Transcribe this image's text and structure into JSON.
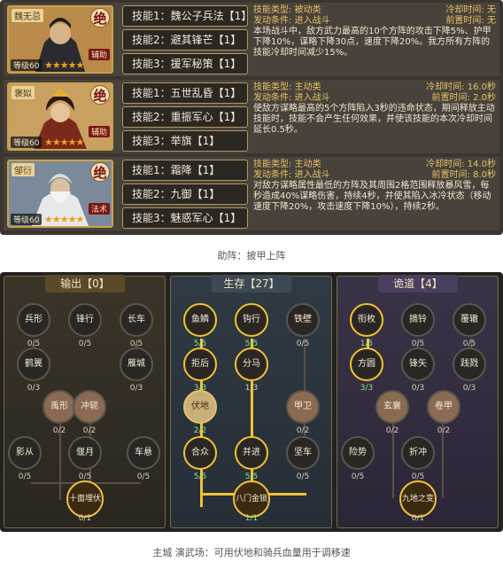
{
  "heroes": [
    {
      "name": "魏无忌",
      "badge": "绝",
      "tag": "辅助",
      "level": "等级60",
      "stars": "★★★★★",
      "skills": [
        "技能1：魏公子兵法【1】",
        "技能2：避其锋芒【1】",
        "技能3：援军秘策【1】"
      ],
      "type": "技能类型: 被动类",
      "condition": "发动条件: 进入战斗",
      "cooldown": "冷却时间: 无",
      "precast": "前置时间: 无",
      "text": "本场战斗中，敌方武力最高的10个方阵的攻击下降5%、护甲下降10%，谋略下降30点，速度下降20%。我方所有方阵的技能冷却时间减少15%。"
    },
    {
      "name": "褒姒",
      "badge": "绝",
      "tag": "辅助",
      "level": "等级60",
      "stars": "★★★★★",
      "skills": [
        "技能1：五世乱昏【1】",
        "技能2：重振军心【1】",
        "技能3：举旗【1】"
      ],
      "type": "技能类型: 主动类",
      "condition": "发动条件: 进入战斗",
      "cooldown": "冷却时间: 16.0秒",
      "precast": "前置时间: 2.0秒",
      "text": "使敌方谋略最高的5个方阵陷入3秒的违命状态，期间释放主动技能时，技能不会产生任何效果，并使该技能的本次冷却时间延长0.5秒。"
    },
    {
      "name": "邹衍",
      "badge": "绝",
      "tag": "法术",
      "level": "等级60",
      "stars": "★★★★★",
      "skills": [
        "技能1：霜降【1】",
        "技能2：九御【1】",
        "技能3：魅惑军心【1】"
      ],
      "type": "技能类型: 主动类",
      "condition": "发动条件: 进入战斗",
      "cooldown": "冷却时间: 14.0秒",
      "precast": "前置时间: 8.0秒",
      "text": "对敌方谋略属性最低的方阵及其周围2格范围释放暴风雪，每秒造成40%谋略伤害，持续4秒，并使其陷入冰冷状态（移动速度下降20%，攻击速度下降10%），持续2秒。"
    }
  ],
  "caption1": "助阵：披甲上阵",
  "caption2": "主城 演武场：可用伏地和骑兵血量用于调移速",
  "columns": [
    {
      "title": "输出【0】",
      "nodes": [
        {
          "label": "兵形",
          "count": "0/5"
        },
        {
          "label": "锋行",
          "count": "0/5"
        },
        {
          "label": "长车",
          "count": "0/5"
        },
        {
          "label": "鹤翼",
          "count": "0/3"
        },
        {
          "label": "雁城",
          "count": "0/3"
        },
        {
          "label": "禹形",
          "count": "0/2"
        },
        {
          "label": "冲轭",
          "count": "0/2"
        },
        {
          "label": "影从",
          "count": "0/5"
        },
        {
          "label": "偃月",
          "count": "0/5"
        },
        {
          "label": "车悬",
          "count": "0/5"
        },
        {
          "label": "十面埋伏",
          "count": "0/1"
        }
      ]
    },
    {
      "title": "生存【27】",
      "nodes": [
        {
          "label": "鱼鳞",
          "count": "5/5"
        },
        {
          "label": "钩行",
          "count": "5/5"
        },
        {
          "label": "铁壁",
          "count": "0/5"
        },
        {
          "label": "拒后",
          "count": "3/3"
        },
        {
          "label": "分马",
          "count": "1/3"
        },
        {
          "label": "伏地",
          "count": "2/2"
        },
        {
          "label": "甲卫",
          "count": "0/2"
        },
        {
          "label": "合众",
          "count": "5/5"
        },
        {
          "label": "并进",
          "count": "5/5"
        },
        {
          "label": "坚车",
          "count": "0/5"
        },
        {
          "label": "八门金锁",
          "count": "1/1"
        }
      ]
    },
    {
      "title": "诡道【4】",
      "nodes": [
        {
          "label": "衔枚",
          "count": "1/5"
        },
        {
          "label": "摘铃",
          "count": "0/5"
        },
        {
          "label": "覆辙",
          "count": "0/5"
        },
        {
          "label": "方圆",
          "count": "3/3"
        },
        {
          "label": "锋矢",
          "count": "0/3"
        },
        {
          "label": "践戮",
          "count": "0/3"
        },
        {
          "label": "玄襄",
          "count": "0/2"
        },
        {
          "label": "卷甲",
          "count": "0/2"
        },
        {
          "label": "险势",
          "count": "0/5"
        },
        {
          "label": "折冲",
          "count": "0/5"
        },
        {
          "label": "九地之变",
          "count": "0/1"
        }
      ]
    }
  ],
  "colors": {
    "gold": "#f2c230",
    "frame": "#b5965a",
    "panel": "#3a3530"
  }
}
